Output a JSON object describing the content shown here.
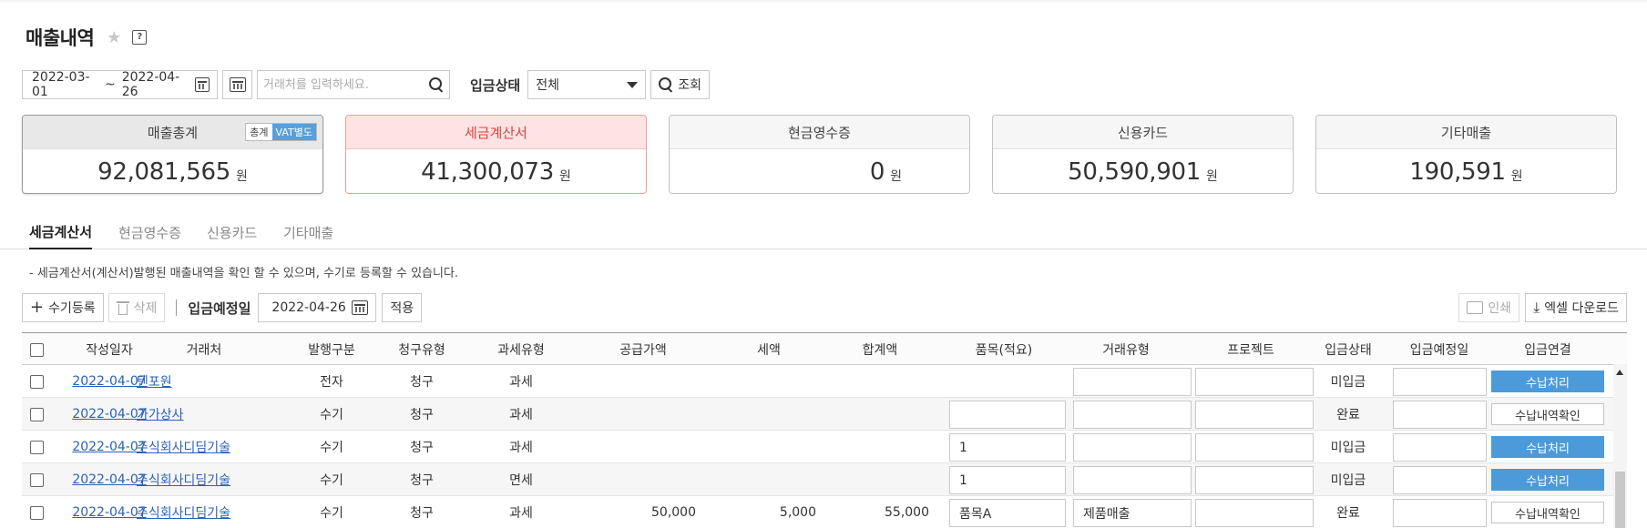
{
  "page": {
    "title": "매출내역"
  },
  "filters": {
    "date_from": "2022-03-01",
    "date_sep": "~",
    "date_to": "2022-04-26",
    "search_placeholder": "거래처를 입력하세요.",
    "status_label": "입금상태",
    "status_value": "전체",
    "query_label": "조회"
  },
  "cards": {
    "total": {
      "label": "매출총계",
      "amount": "92,081,565",
      "unit": "원",
      "toggle_total": "총계",
      "toggle_vat": "VAT별도"
    },
    "tax_invoice": {
      "label": "세금계산서",
      "amount": "41,300,073",
      "unit": "원"
    },
    "cash_receipt": {
      "label": "현금영수증",
      "amount": "0",
      "unit": "원"
    },
    "credit_card": {
      "label": "신용카드",
      "amount": "50,590,901",
      "unit": "원"
    },
    "other": {
      "label": "기타매출",
      "amount": "190,591",
      "unit": "원"
    }
  },
  "tabs": [
    "세금계산서",
    "현금영수증",
    "신용카드",
    "기타매출"
  ],
  "description": "- 세금계산서(계산서)발행된 매출내역을 확인 할 수 있으며, 수기로 등록할 수 있습니다.",
  "actions": {
    "manual_add": "수기등록",
    "delete": "삭제",
    "due_label": "입금예정일",
    "due_date": "2022-04-26",
    "apply": "적용",
    "print": "인쇄",
    "excel": "엑셀 다운로드"
  },
  "table": {
    "columns": [
      "작성일자",
      "거래처",
      "발행구분",
      "청구유형",
      "과세유형",
      "공급가액",
      "세액",
      "합계액",
      "품목(적요)",
      "거래유형",
      "프로젝트",
      "입금상태",
      "입금예정일",
      "입금연결"
    ],
    "rows": [
      {
        "date": "2022-04-07",
        "vendor": "텐포원",
        "issue": "전자",
        "claim": "청구",
        "tax": "과세",
        "supply": "",
        "vat": "",
        "sum": "",
        "item": "",
        "trade": "",
        "project": "",
        "status": "미입금",
        "due": "",
        "action": "수납처리",
        "action_style": "blue",
        "item_box": false
      },
      {
        "date": "2022-04-07",
        "vendor": "가가상사",
        "issue": "수기",
        "claim": "청구",
        "tax": "과세",
        "supply": "",
        "vat": "",
        "sum": "",
        "item": "",
        "trade": "",
        "project": "",
        "status": "완료",
        "due": "",
        "action": "수납내역확인",
        "action_style": "white",
        "item_box": true
      },
      {
        "date": "2022-04-07",
        "vendor": "주식회사디딤기술",
        "issue": "수기",
        "claim": "청구",
        "tax": "과세",
        "supply": "",
        "vat": "",
        "sum": "",
        "item": "1",
        "trade": "",
        "project": "",
        "status": "미입금",
        "due": "",
        "action": "수납처리",
        "action_style": "blue",
        "item_box": true
      },
      {
        "date": "2022-04-07",
        "vendor": "주식회사디딤기술",
        "issue": "수기",
        "claim": "청구",
        "tax": "면세",
        "supply": "",
        "vat": "",
        "sum": "",
        "item": "1",
        "trade": "",
        "project": "",
        "status": "미입금",
        "due": "",
        "action": "수납처리",
        "action_style": "blue",
        "item_box": true
      },
      {
        "date": "2022-04-07",
        "vendor": "주식회사디딤기술",
        "issue": "수기",
        "claim": "청구",
        "tax": "과세",
        "supply": "50,000",
        "vat": "5,000",
        "sum": "55,000",
        "item": "품목A",
        "trade": "제품매출",
        "project": "",
        "status": "완료",
        "due": "",
        "action": "수납내역확인",
        "action_style": "white",
        "item_box": true
      }
    ]
  },
  "colors": {
    "accent_blue": "#4c9ad9",
    "selected_red": "#e53e3e",
    "link": "#2a62b8"
  }
}
